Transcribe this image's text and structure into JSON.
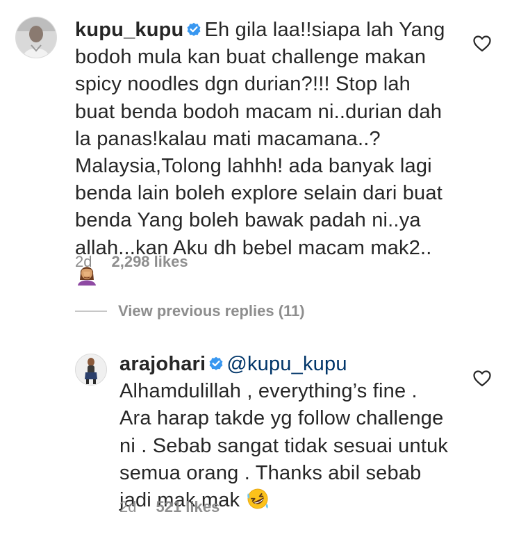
{
  "comments": [
    {
      "username": "kupu_kupu",
      "verified": true,
      "lines": [
        "Eh gila laa!!siapa lah Yang",
        "bodoh mula kan buat challenge makan",
        "spicy noodles dgn durian?!!! Stop lah",
        "buat benda bodoh macam ni..durian dah",
        "la panas!kalau mati macamana..?",
        "Malaysia,Tolong lahhh! ada banyak lagi",
        "benda lain boleh explore selain dari buat",
        "benda Yang boleh bawak padah ni..ya",
        "allah...kan Aku dh bebel macam mak2.."
      ],
      "emoji": "woman-facepalming-emoji",
      "time": "2d",
      "likes": "2,298 likes"
    },
    {
      "username": "arajohari",
      "verified": true,
      "mention": "@kupu_kupu",
      "lines": [
        "Alhamdulillah , everything’s fine .",
        "Ara harap takde yg follow challenge",
        "ni . Sebab sangat tidak sesuai untuk",
        "semua orang . Thanks abil sebab",
        "jadi mak mak"
      ],
      "emoji": "rolling-on-floor-laughing-emoji",
      "time": "2d",
      "likes": "521 likes"
    }
  ],
  "view_previous_replies": "View previous replies (11)",
  "colors": {
    "text": "#262626",
    "meta": "#8e8e8e",
    "verified": "#3897f0",
    "mention": "#003569",
    "divider": "#c7c7c7"
  }
}
